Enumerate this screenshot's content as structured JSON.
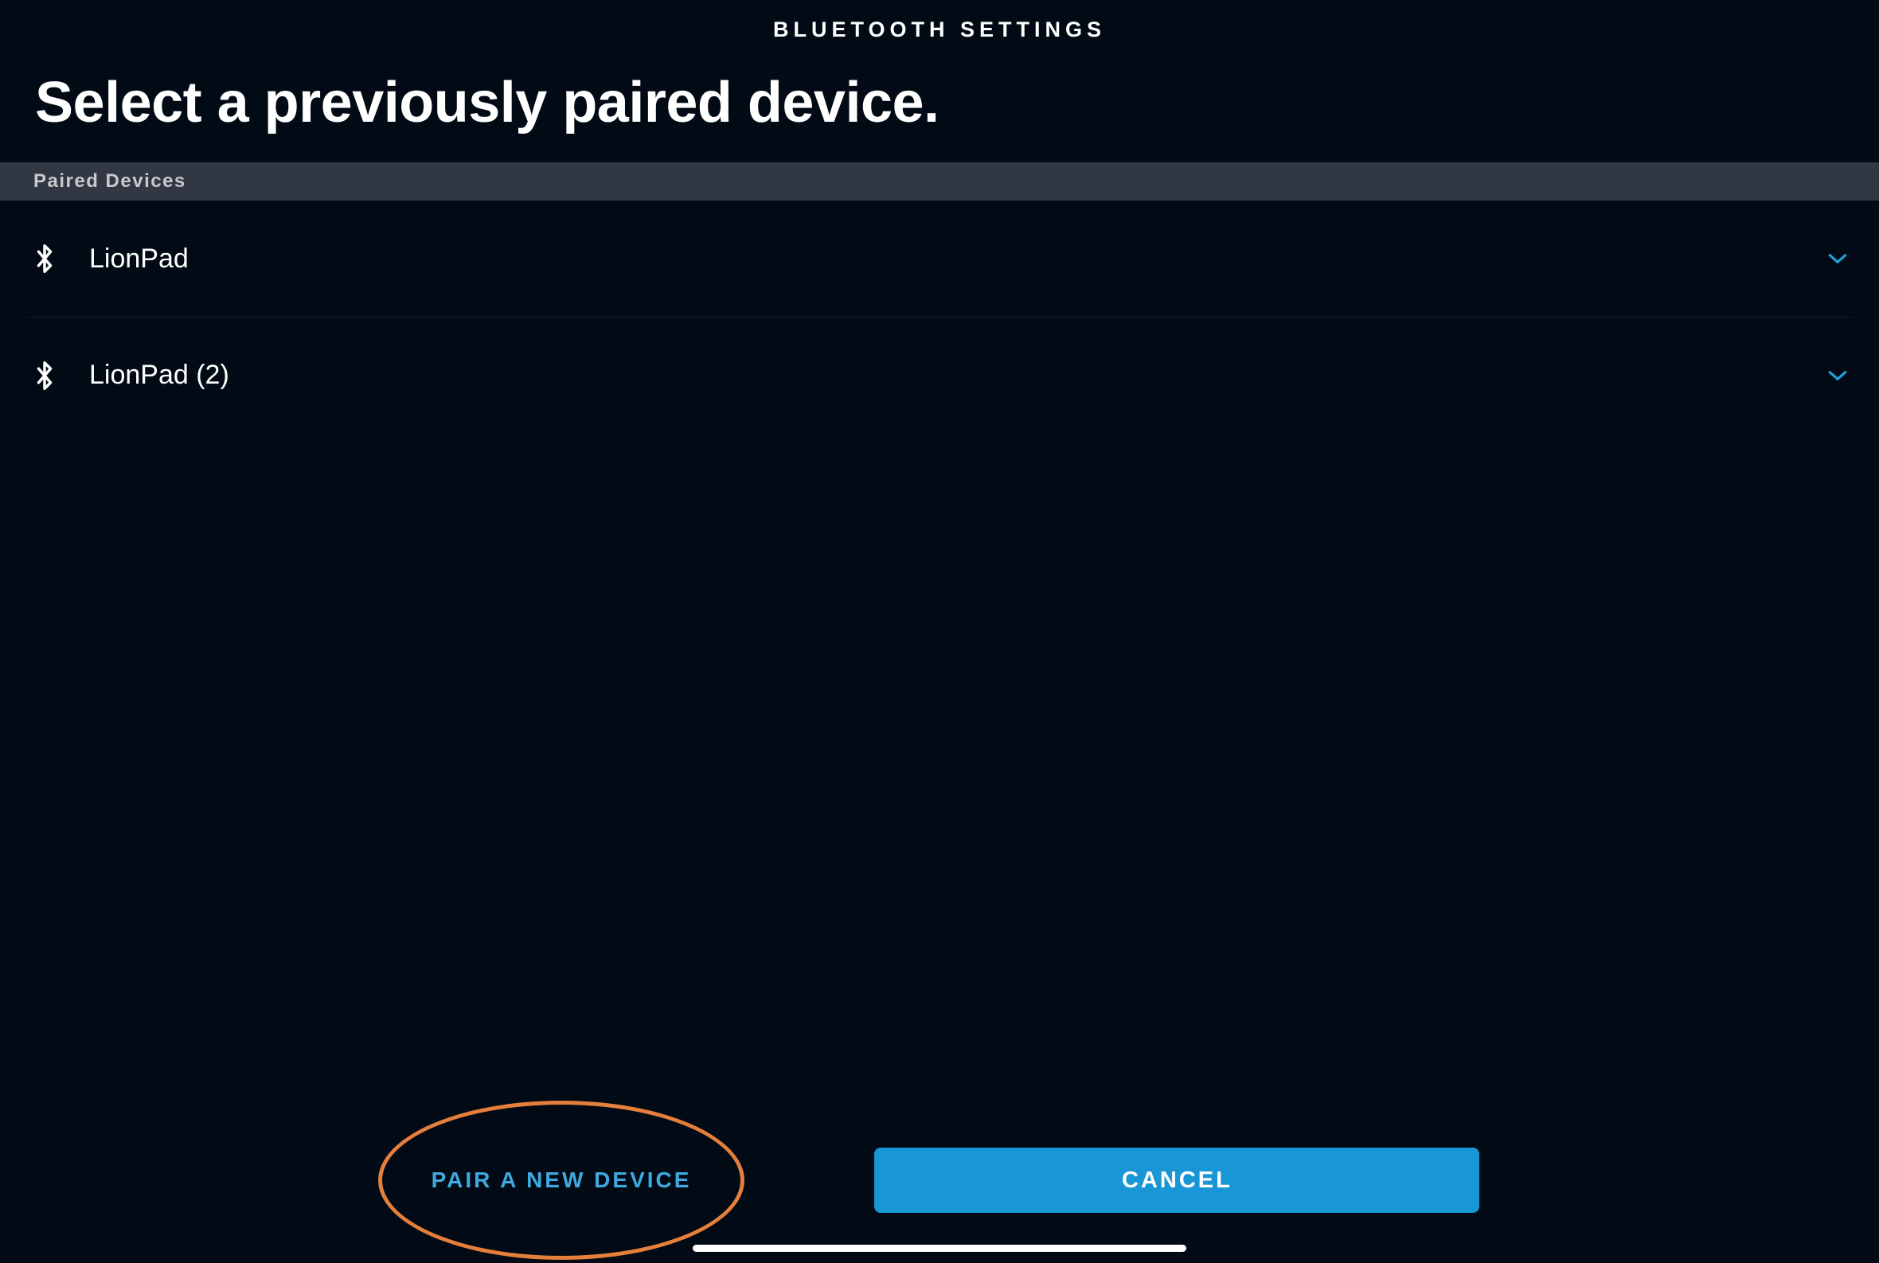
{
  "header": {
    "status_title": "BLUETOOTH SETTINGS",
    "page_heading": "Select a previously paired device."
  },
  "section": {
    "label": "Paired Devices"
  },
  "devices": [
    {
      "name": "LionPad"
    },
    {
      "name": "LionPad (2)"
    }
  ],
  "actions": {
    "pair_label": "PAIR A NEW DEVICE",
    "cancel_label": "CANCEL"
  },
  "colors": {
    "accent_blue": "#1996d6",
    "accent_orange": "#e67e3c"
  }
}
